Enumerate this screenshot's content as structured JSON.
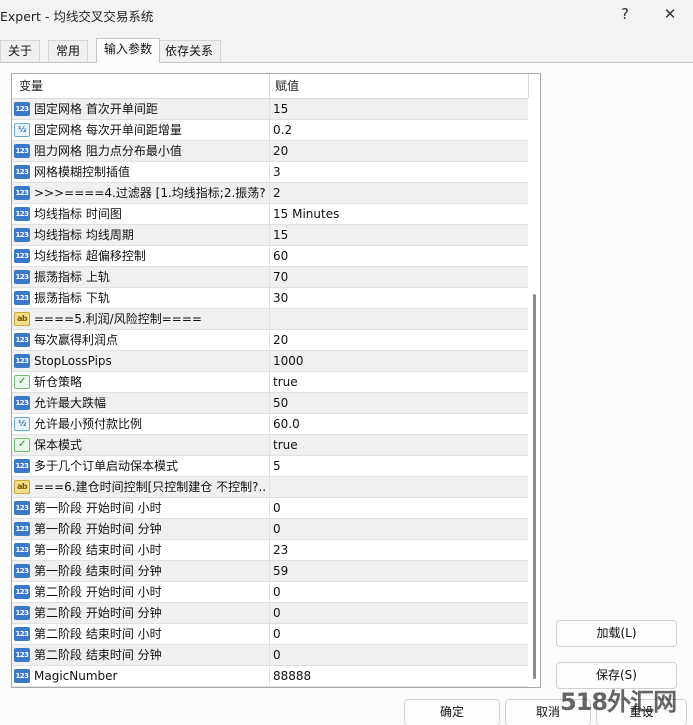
{
  "window": {
    "title": "Expert - 均线交叉交易系统",
    "help_glyph": "?",
    "close_glyph": "✕"
  },
  "tabs": [
    {
      "label": "关于",
      "active": false
    },
    {
      "label": "常用",
      "active": false
    },
    {
      "label": "输入参数",
      "active": true
    },
    {
      "label": "依存关系",
      "active": false
    }
  ],
  "grid": {
    "col_variable": "变量",
    "col_value": "赋值",
    "rows": [
      {
        "type": "int",
        "icon_text": "123",
        "name": "固定网格 首次开单间距",
        "value": "15"
      },
      {
        "type": "double",
        "icon_text": "½",
        "name": "固定网格 每次开单间距增量",
        "value": "0.2"
      },
      {
        "type": "int",
        "icon_text": "123",
        "name": "阻力网格 阻力点分布最小值",
        "value": "20"
      },
      {
        "type": "int",
        "icon_text": "123",
        "name": "网格模糊控制插值",
        "value": "3"
      },
      {
        "type": "int",
        "icon_text": "123",
        "name": ">>>====4.过滤器 [1.均线指标;2.振荡?..",
        "value": "2"
      },
      {
        "type": "int",
        "icon_text": "123",
        "name": "均线指标 时间图",
        "value": "15 Minutes"
      },
      {
        "type": "int",
        "icon_text": "123",
        "name": "均线指标 均线周期",
        "value": "15"
      },
      {
        "type": "int",
        "icon_text": "123",
        "name": "均线指标 超偏移控制",
        "value": "60"
      },
      {
        "type": "int",
        "icon_text": "123",
        "name": "振荡指标 上轨",
        "value": "70"
      },
      {
        "type": "int",
        "icon_text": "123",
        "name": "振荡指标 下轨",
        "value": "30"
      },
      {
        "type": "string",
        "icon_text": "ab",
        "name": "====5.利润/风险控制====",
        "value": ""
      },
      {
        "type": "int",
        "icon_text": "123",
        "name": "每次赢得利润点",
        "value": "20"
      },
      {
        "type": "int",
        "icon_text": "123",
        "name": "StopLossPips",
        "value": "1000"
      },
      {
        "type": "bool",
        "icon_text": "✓",
        "name": "斩仓策略",
        "value": "true"
      },
      {
        "type": "int",
        "icon_text": "123",
        "name": "允许最大跌幅",
        "value": "50"
      },
      {
        "type": "double",
        "icon_text": "½",
        "name": "允许最小预付款比例",
        "value": "60.0"
      },
      {
        "type": "bool",
        "icon_text": "✓",
        "name": "保本模式",
        "value": "true"
      },
      {
        "type": "int",
        "icon_text": "123",
        "name": "多于几个订单启动保本模式",
        "value": "5"
      },
      {
        "type": "string",
        "icon_text": "ab",
        "name": "===6.建仓时间控制[只控制建仓 不控制?..",
        "value": ""
      },
      {
        "type": "int",
        "icon_text": "123",
        "name": "第一阶段 开始时间 小时",
        "value": "0"
      },
      {
        "type": "int",
        "icon_text": "123",
        "name": "第一阶段 开始时间 分钟",
        "value": "0"
      },
      {
        "type": "int",
        "icon_text": "123",
        "name": "第一阶段 结束时间 小时",
        "value": "23"
      },
      {
        "type": "int",
        "icon_text": "123",
        "name": "第一阶段 结束时间 分钟",
        "value": "59"
      },
      {
        "type": "int",
        "icon_text": "123",
        "name": "第二阶段 开始时间 小时",
        "value": "0"
      },
      {
        "type": "int",
        "icon_text": "123",
        "name": "第二阶段 开始时间 分钟",
        "value": "0"
      },
      {
        "type": "int",
        "icon_text": "123",
        "name": "第二阶段 结束时间 小时",
        "value": "0"
      },
      {
        "type": "int",
        "icon_text": "123",
        "name": "第二阶段 结束时间 分钟",
        "value": "0"
      },
      {
        "type": "int",
        "icon_text": "123",
        "name": "MagicNumber",
        "value": "88888"
      }
    ]
  },
  "side_buttons": {
    "load": "加载(L)",
    "save": "保存(S)"
  },
  "bottom_buttons": {
    "ok": "确定",
    "cancel": "取消",
    "reset": "重设"
  },
  "watermark": "518外汇网"
}
